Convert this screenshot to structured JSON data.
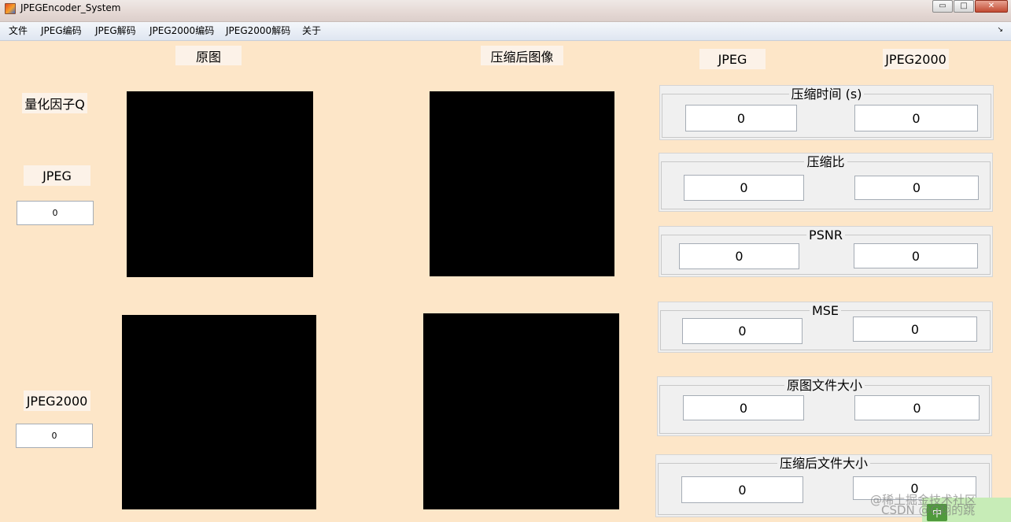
{
  "window": {
    "title": "JPEGEncoder_System",
    "buttons": {
      "minimize": "▭",
      "maximize": "□",
      "close": "✕"
    }
  },
  "menu": {
    "items": [
      "文件",
      "JPEG编码",
      "JPEG解码",
      "JPEG2000编码",
      "JPEG2000解码",
      "关于"
    ],
    "overflow": "↘"
  },
  "headers": {
    "original": "原图",
    "compressed": "压缩后图像",
    "jpeg": "JPEG",
    "jpeg2000": "JPEG2000"
  },
  "left": {
    "q_label": "量化因子Q",
    "jpeg_label": "JPEG",
    "jpeg_value": "0",
    "jpeg2000_label": "JPEG2000",
    "jpeg2000_value": "0"
  },
  "panels": [
    {
      "title": "压缩时间 (s)",
      "jpeg": "0",
      "jpeg2000": "0"
    },
    {
      "title": "压缩比",
      "jpeg": "0",
      "jpeg2000": "0"
    },
    {
      "title": "PSNR",
      "jpeg": "0",
      "jpeg2000": "0"
    },
    {
      "title": "MSE",
      "jpeg": "0",
      "jpeg2000": "0"
    },
    {
      "title": "原图文件大小",
      "jpeg": "0",
      "jpeg2000": "0"
    },
    {
      "title": "压缩后文件大小",
      "jpeg": "0",
      "jpeg2000": "0"
    }
  ],
  "watermark": {
    "line1": "@稀土掘金技术社区",
    "line2": "CSDN @G翔的跳"
  },
  "ime": {
    "label": "中"
  },
  "colors": {
    "background": "#fde6c8",
    "label_bg": "#fcf2e8",
    "panel_bg": "#f0f0f0",
    "axes": "#000000"
  }
}
